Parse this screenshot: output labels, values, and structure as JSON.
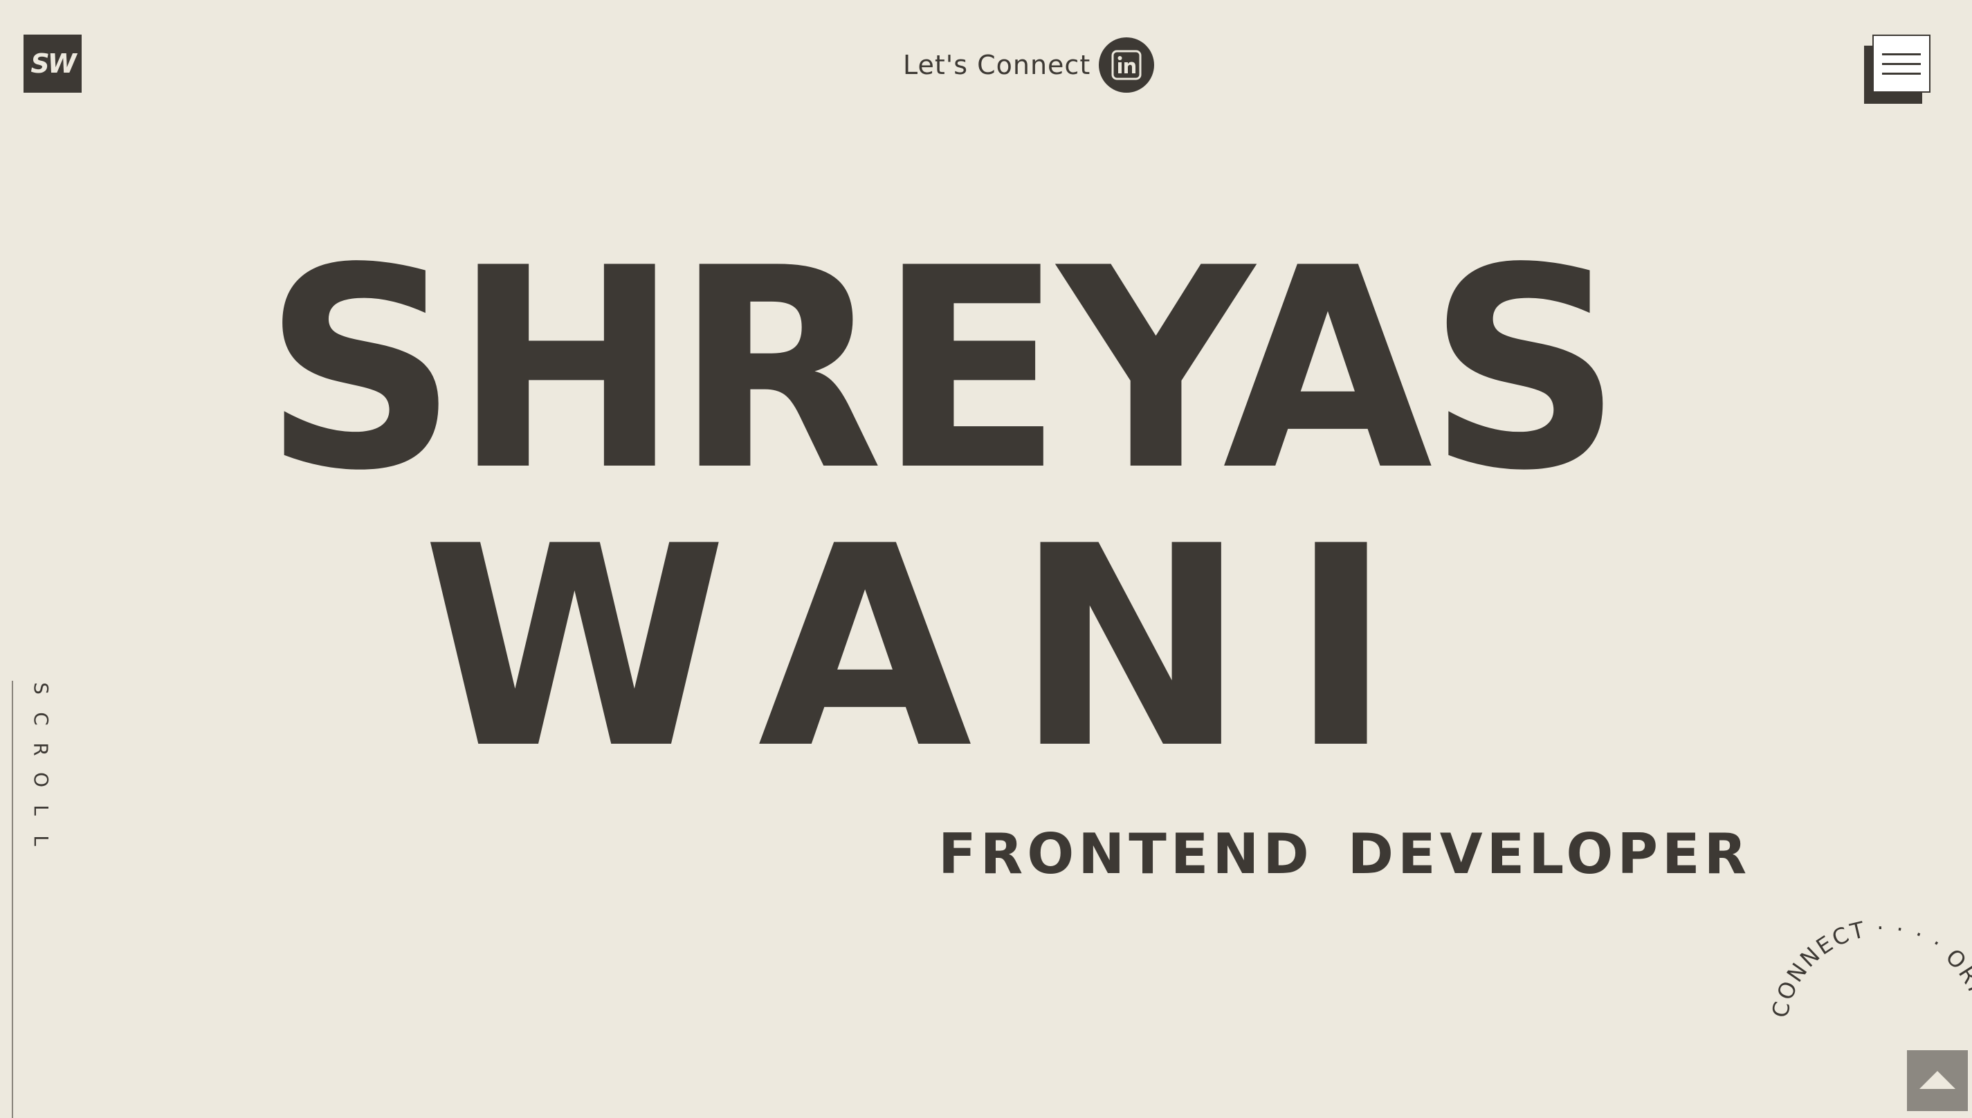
{
  "header": {
    "logo_text": "SW",
    "connect_label": "Let's Connect",
    "connect_icon": "linkedin-icon",
    "menu_icon": "hamburger-menu-icon"
  },
  "hero": {
    "first_name": "SHREYAS",
    "last_name": "WANI",
    "role": "FRONTEND  DEVELOPER"
  },
  "scroll": {
    "letters": [
      "S",
      "C",
      "R",
      "O",
      "L",
      "L"
    ]
  },
  "circle_badge": {
    "text": "CONNECT · · · · ORM · ·"
  },
  "back_to_top": {
    "icon": "arrow-up-icon"
  },
  "colors": {
    "background": "#ede9de",
    "foreground": "#3d3934",
    "button_gray": "#8c8881"
  }
}
